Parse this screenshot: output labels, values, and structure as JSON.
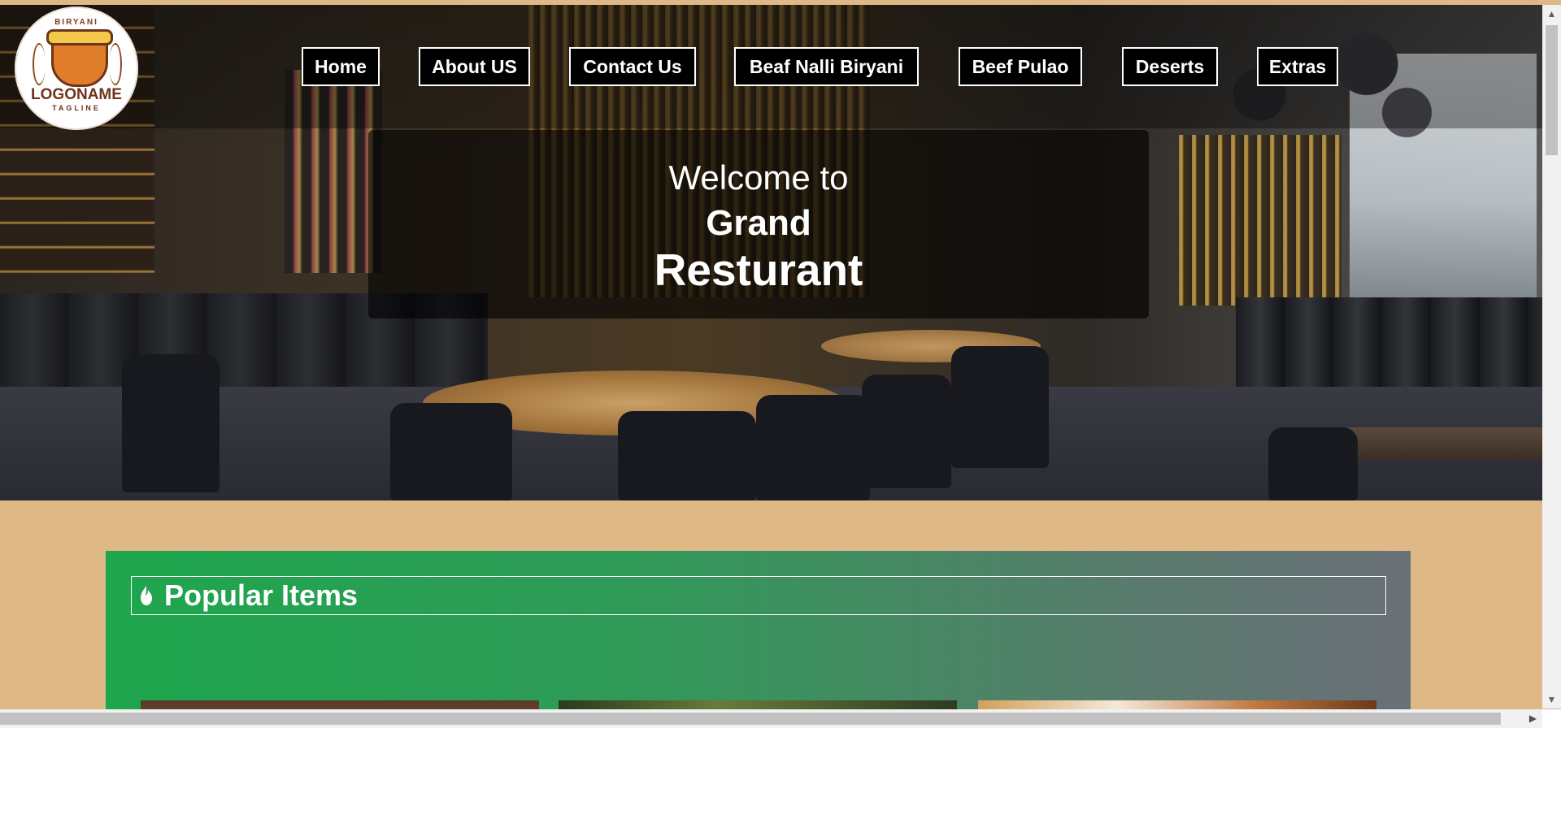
{
  "logo": {
    "ring_text": "BIRYANI",
    "name": "LOGONAME",
    "tagline": "TAGLINE"
  },
  "nav": {
    "items": [
      {
        "label": "Home"
      },
      {
        "label": "About US"
      },
      {
        "label": "Contact Us"
      },
      {
        "label": "Beaf Nalli Biryani"
      },
      {
        "label": "Beef Pulao"
      },
      {
        "label": "Deserts"
      },
      {
        "label": "Extras"
      }
    ]
  },
  "hero": {
    "line1": "Welcome to",
    "line2": "Grand",
    "line3": "Resturant"
  },
  "popular": {
    "title": "Popular Items",
    "icon": "flame-icon"
  },
  "colors": {
    "page_background": "#deb887",
    "section_gradient_start": "#1ea64d",
    "section_gradient_end": "#6a7078",
    "nav_button_bg": "#000000",
    "nav_button_border": "#ffffff"
  },
  "scrollbars": {
    "up_icon": "▲",
    "down_icon": "▼",
    "right_icon": "▶"
  }
}
